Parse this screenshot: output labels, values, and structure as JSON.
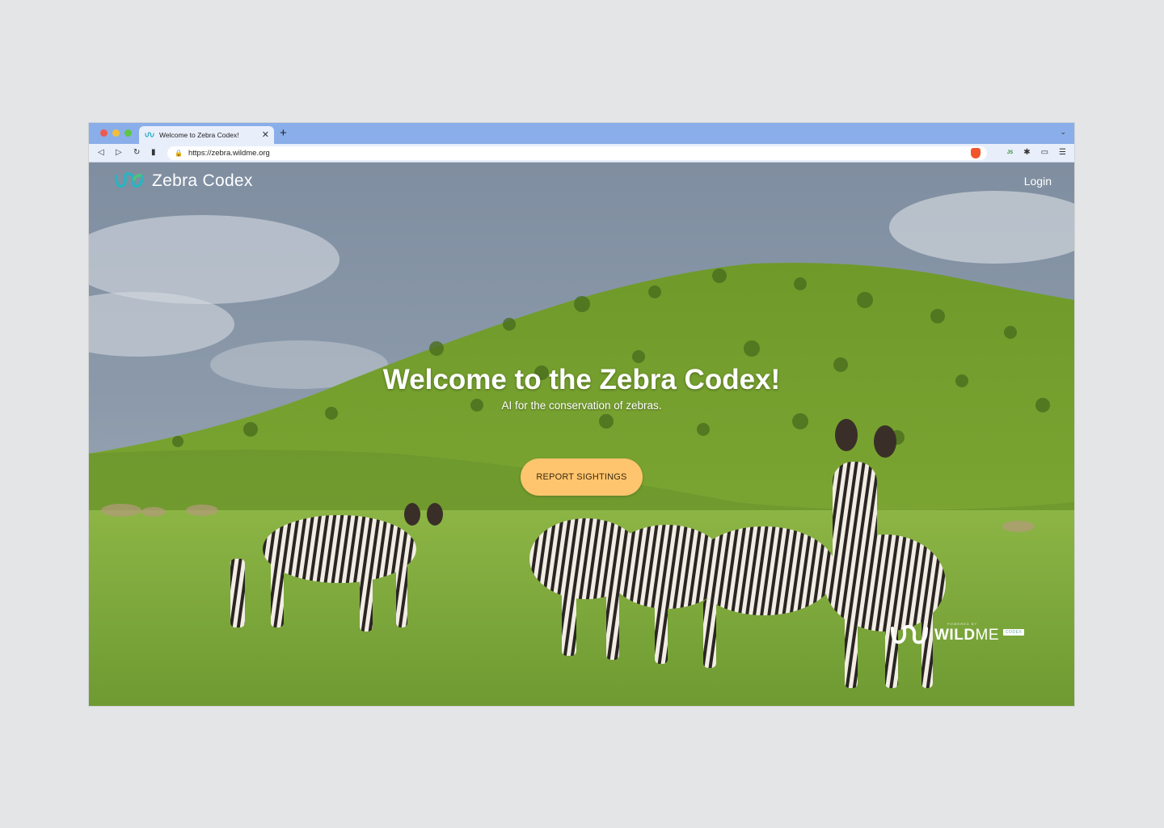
{
  "browser": {
    "tab": {
      "title": "Welcome to Zebra Codex!",
      "favicon": "zebra-codex-logo-icon",
      "close_glyph": "✕"
    },
    "new_tab_glyph": "+",
    "tab_menu_glyph": "⌄",
    "url": "https://zebra.wildme.org",
    "nav": {
      "back": "◁",
      "forward": "▷",
      "reload": "↻",
      "bookmark": "▮"
    },
    "lock_glyph": "🔒",
    "extensions": {
      "js": "JS",
      "puzzle": "✱",
      "wallet": "▭",
      "menu": "☰"
    }
  },
  "site": {
    "name": "Zebra Codex",
    "login_label": "Login",
    "hero": {
      "title": "Welcome to the Zebra Codex!",
      "subtitle": "AI for the conservation of zebras.",
      "cta_label": "REPORT SIGHTINGS"
    },
    "badge": {
      "powered_by": "POWERED BY",
      "wild": "WILD",
      "me": "ME",
      "codex": "CODEX"
    }
  },
  "colors": {
    "tab_strip": "#8aaee9",
    "cta_background": "#ffc56e",
    "logo_teal": "#2bb3c0",
    "logo_green": "#4cc37f"
  }
}
